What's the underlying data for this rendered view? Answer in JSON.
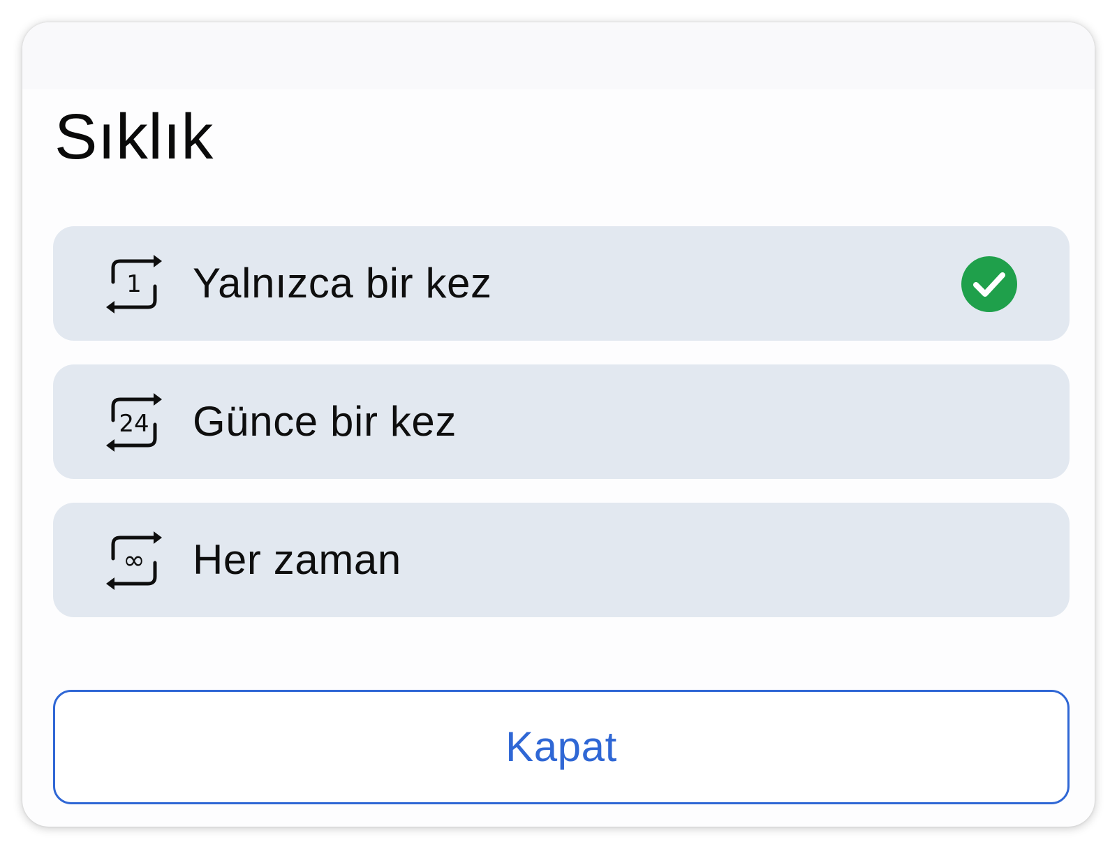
{
  "dialog": {
    "title": "Sıklık"
  },
  "options": [
    {
      "label": "Yalnızca bir kez",
      "icon": "repeat-once-icon",
      "icon_glyph": "1",
      "selected": true
    },
    {
      "label": "Günce bir kez",
      "icon": "repeat-daily-icon",
      "icon_glyph": "24",
      "selected": false
    },
    {
      "label": "Her zaman",
      "icon": "repeat-always-icon",
      "icon_glyph": "∞",
      "selected": false
    }
  ],
  "close_button": {
    "label": "Kapat"
  },
  "colors": {
    "accent": "#2f67d5",
    "selected_check": "#1fa04b",
    "option_background": "#e2e8f0"
  }
}
